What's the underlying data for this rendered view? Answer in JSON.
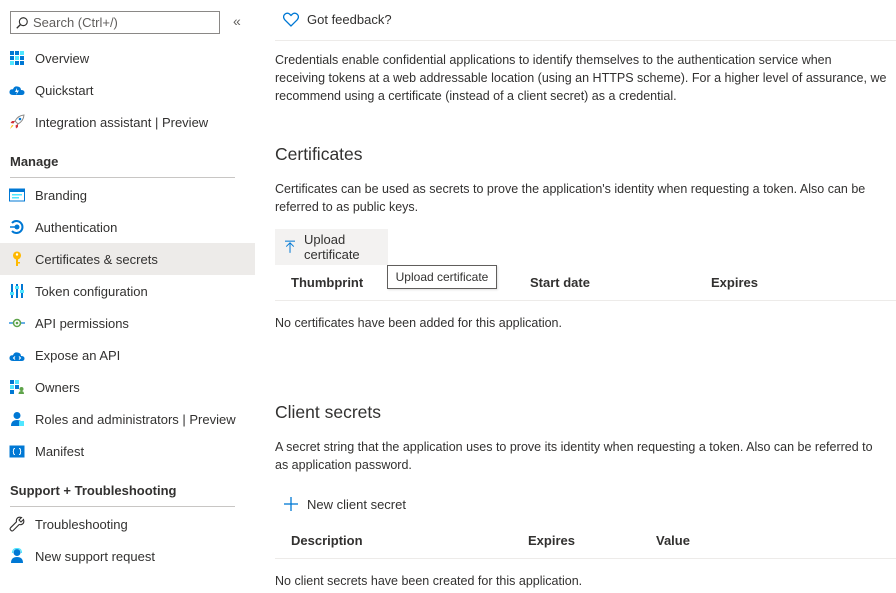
{
  "sidebar": {
    "search_placeholder": "Search (Ctrl+/)",
    "collapse_glyph": "«",
    "top_items": [
      {
        "label": "Overview"
      },
      {
        "label": "Quickstart"
      },
      {
        "label": "Integration assistant | Preview"
      }
    ],
    "manage_heading": "Manage",
    "manage_items": [
      {
        "label": "Branding"
      },
      {
        "label": "Authentication"
      },
      {
        "label": "Certificates & secrets",
        "active": true
      },
      {
        "label": "Token configuration"
      },
      {
        "label": "API permissions"
      },
      {
        "label": "Expose an API"
      },
      {
        "label": "Owners"
      },
      {
        "label": "Roles and administrators | Preview"
      },
      {
        "label": "Manifest"
      }
    ],
    "support_heading": "Support + Troubleshooting",
    "support_items": [
      {
        "label": "Troubleshooting"
      },
      {
        "label": "New support request"
      }
    ]
  },
  "main": {
    "feedback_label": "Got feedback?",
    "intro_lines": [
      "Credentials enable confidential applications to identify themselves to the authentication service when",
      "receiving tokens at a web addressable location (using an HTTPS scheme). For a higher level of assurance, we",
      "recommend using a certificate (instead of a client secret) as a credential."
    ],
    "certificates": {
      "heading": "Certificates",
      "desc_lines": [
        "Certificates can be used as secrets to prove the application's identity when requesting a token. Also can be",
        "referred to as public keys."
      ],
      "upload_label": "Upload certificate",
      "tooltip": "Upload certificate",
      "columns": [
        "Thumbprint",
        "Start date",
        "Expires"
      ],
      "empty_text": "No certificates have been added for this application."
    },
    "secrets": {
      "heading": "Client secrets",
      "desc_lines": [
        "A secret string that the application uses to prove its identity when requesting a token. Also can be referred to",
        "as application password."
      ],
      "new_label": "New client secret",
      "columns": [
        "Description",
        "Expires",
        "Value"
      ],
      "empty_text": "No client secrets have been created for this application."
    }
  },
  "colors": {
    "accent": "#0078d4",
    "active_bg": "#edebe9"
  }
}
